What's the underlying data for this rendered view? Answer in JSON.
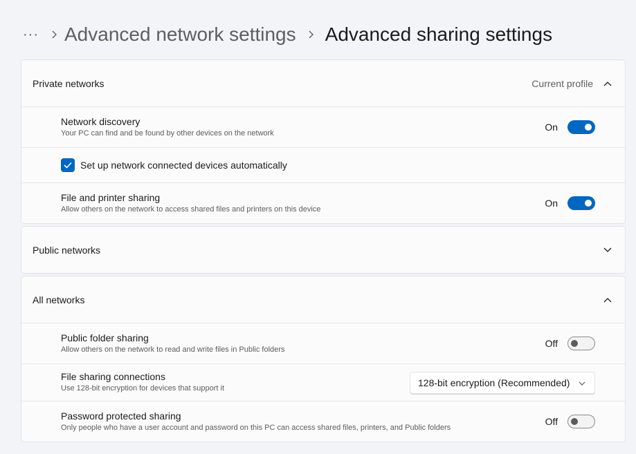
{
  "breadcrumb": {
    "more": "···",
    "items": [
      "Advanced network settings",
      "Advanced sharing settings"
    ]
  },
  "private": {
    "title": "Private networks",
    "note": "Current profile",
    "network_discovery": {
      "title": "Network discovery",
      "desc": "Your PC can find and be found by other devices on the network",
      "state": "On"
    },
    "auto_setup": {
      "label": "Set up network connected devices automatically",
      "checked": true
    },
    "file_printer": {
      "title": "File and printer sharing",
      "desc": "Allow others on the network to access shared files and printers on this device",
      "state": "On"
    }
  },
  "public": {
    "title": "Public networks"
  },
  "all": {
    "title": "All networks",
    "public_folder": {
      "title": "Public folder sharing",
      "desc": "Allow others on the network to read and write files in Public folders",
      "state": "Off"
    },
    "file_sharing_conn": {
      "title": "File sharing connections",
      "desc": "Use 128-bit encryption for devices that support it",
      "value": "128-bit encryption (Recommended)"
    },
    "password_sharing": {
      "title": "Password protected sharing",
      "desc": "Only people who have a user account and password on this PC can access shared files, printers, and Public folders",
      "state": "Off"
    }
  },
  "colors": {
    "accent": "#0067c0",
    "background": "#f3f4f8",
    "card": "#fbfbfc"
  }
}
